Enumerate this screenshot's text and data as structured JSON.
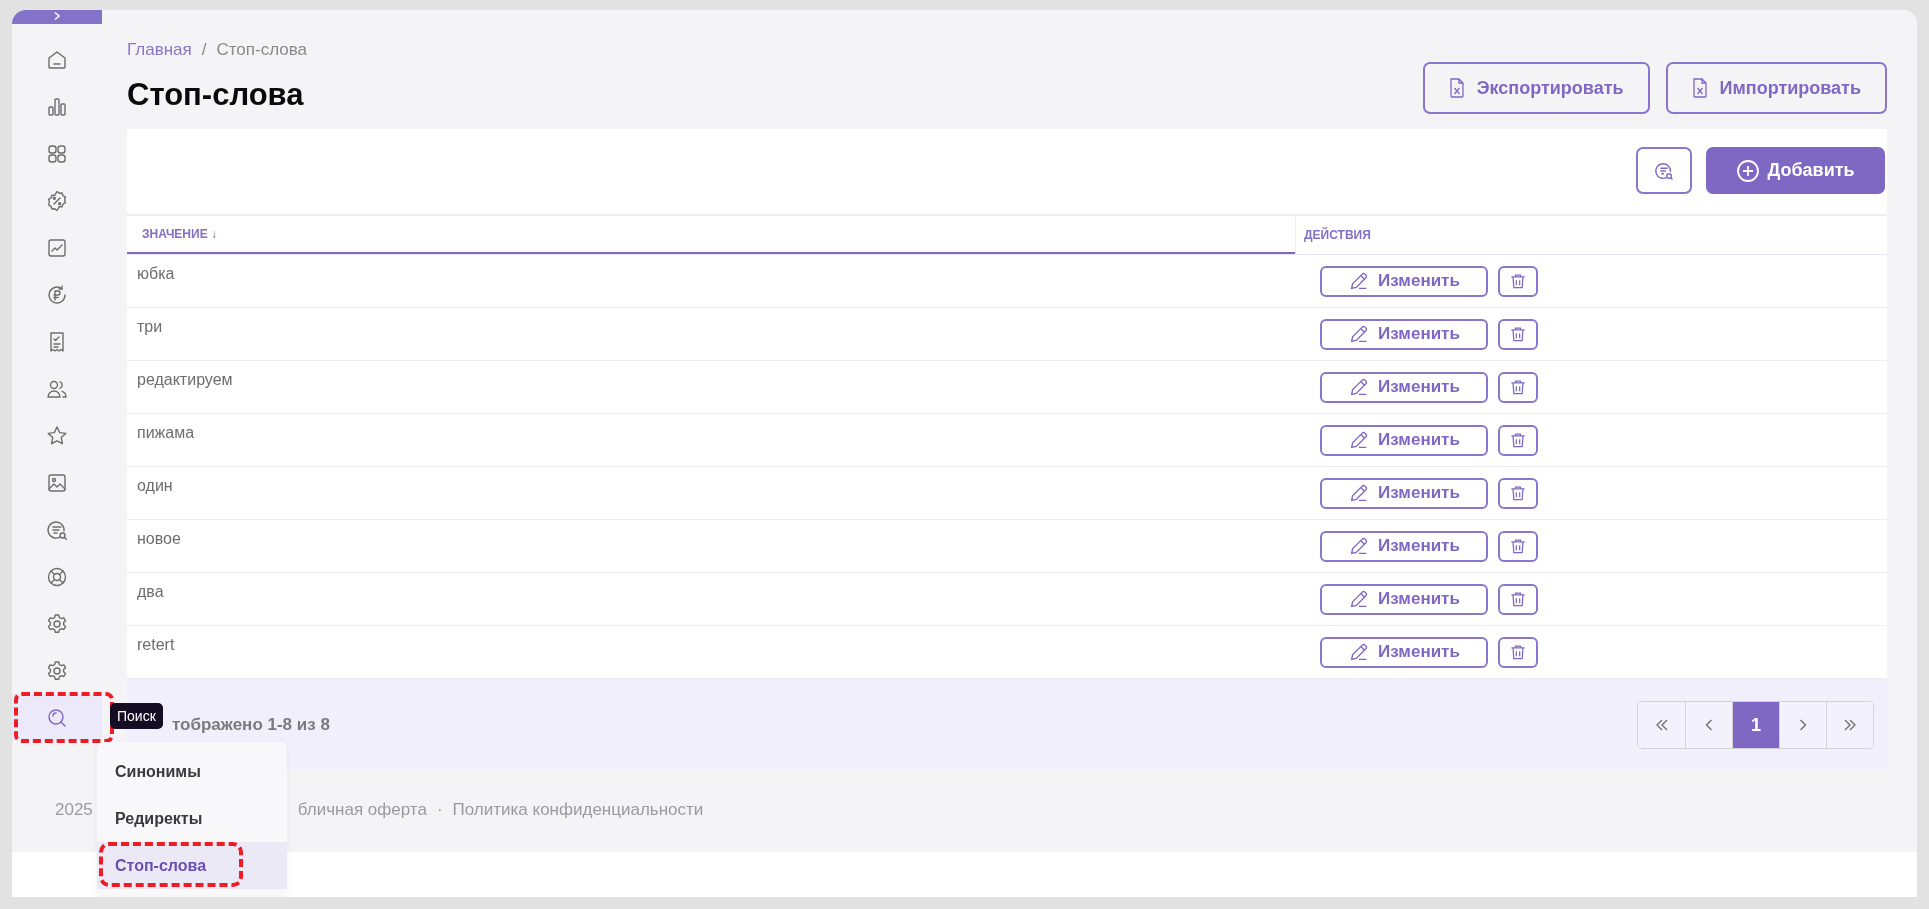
{
  "sidebar": {
    "items": [
      {
        "kind": "home",
        "selected": false
      },
      {
        "kind": "bars",
        "selected": false
      },
      {
        "kind": "grid",
        "selected": false
      },
      {
        "kind": "percent",
        "selected": false
      },
      {
        "kind": "trend",
        "selected": false
      },
      {
        "kind": "ruble",
        "selected": false
      },
      {
        "kind": "receipt",
        "selected": false
      },
      {
        "kind": "users",
        "selected": false
      },
      {
        "kind": "star",
        "selected": false
      },
      {
        "kind": "image",
        "selected": false
      },
      {
        "kind": "listsearch",
        "selected": false
      },
      {
        "kind": "lifebuoy",
        "selected": false
      },
      {
        "kind": "gear",
        "selected": false
      },
      {
        "kind": "gear",
        "selected": false
      },
      {
        "kind": "search",
        "selected": true
      }
    ],
    "tooltip": "Поиск",
    "submenu": [
      {
        "label": "Синонимы",
        "selected": false
      },
      {
        "label": "Редиректы",
        "selected": false
      },
      {
        "label": "Стоп-слова",
        "selected": true
      }
    ]
  },
  "breadcrumb": [
    {
      "label": "Главная",
      "kind": "link"
    },
    {
      "label": "/",
      "kind": "separator"
    },
    {
      "label": "Стоп-слова",
      "kind": "current"
    }
  ],
  "title": "Стоп-слова",
  "header_buttons": [
    "Экспортировать",
    "Импортировать"
  ],
  "add_button": "Добавить",
  "table": {
    "columns": [
      {
        "label": "ЗНАЧЕНИЕ",
        "sort": "↓"
      },
      {
        "label": "ДЕЙСТВИЯ"
      }
    ],
    "rows": [
      {
        "value": "юбка",
        "edit": "Изменить"
      },
      {
        "value": "три",
        "edit": "Изменить"
      },
      {
        "value": "редактируем",
        "edit": "Изменить"
      },
      {
        "value": "пижама",
        "edit": "Изменить"
      },
      {
        "value": "один",
        "edit": "Изменить"
      },
      {
        "value": "новое",
        "edit": "Изменить"
      },
      {
        "value": "два",
        "edit": "Изменить"
      },
      {
        "value": "retert",
        "edit": "Изменить"
      }
    ]
  },
  "summary": "тображено 1-8 из 8",
  "pagination": [
    {
      "kind": "first",
      "selected": false
    },
    {
      "kind": "prev",
      "selected": false
    },
    {
      "label": "1",
      "kind": "page",
      "selected": true
    },
    {
      "kind": "next",
      "selected": false
    },
    {
      "kind": "last",
      "selected": false
    }
  ],
  "footer": {
    "year": "2025",
    "links": [
      "бличная оферта",
      "Политика конфиденциальности"
    ],
    "separator": "·"
  },
  "annotations": {
    "highlight_sidebar": true,
    "highlight_submenu": true
  }
}
